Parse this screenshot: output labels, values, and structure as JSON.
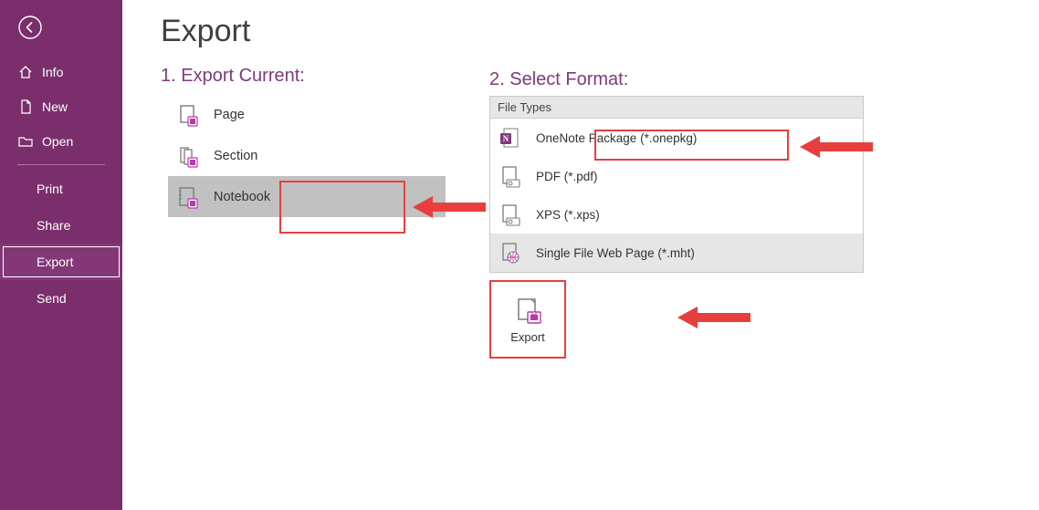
{
  "sidebar": {
    "info": "Info",
    "new": "New",
    "open": "Open",
    "print": "Print",
    "share": "Share",
    "export": "Export",
    "send": "Send"
  },
  "page": {
    "title": "Export"
  },
  "section1": {
    "heading": "1. Export Current:",
    "page_label": "Page",
    "section_label": "Section",
    "notebook_label": "Notebook"
  },
  "section2": {
    "heading": "2. Select Format:",
    "group_header": "File Types",
    "onepkg_label": "OneNote Package (*.onepkg)",
    "pdf_label": "PDF (*.pdf)",
    "xps_label": "XPS (*.xps)",
    "mht_label": "Single File Web Page (*.mht)"
  },
  "export_button": {
    "label": "Export"
  }
}
